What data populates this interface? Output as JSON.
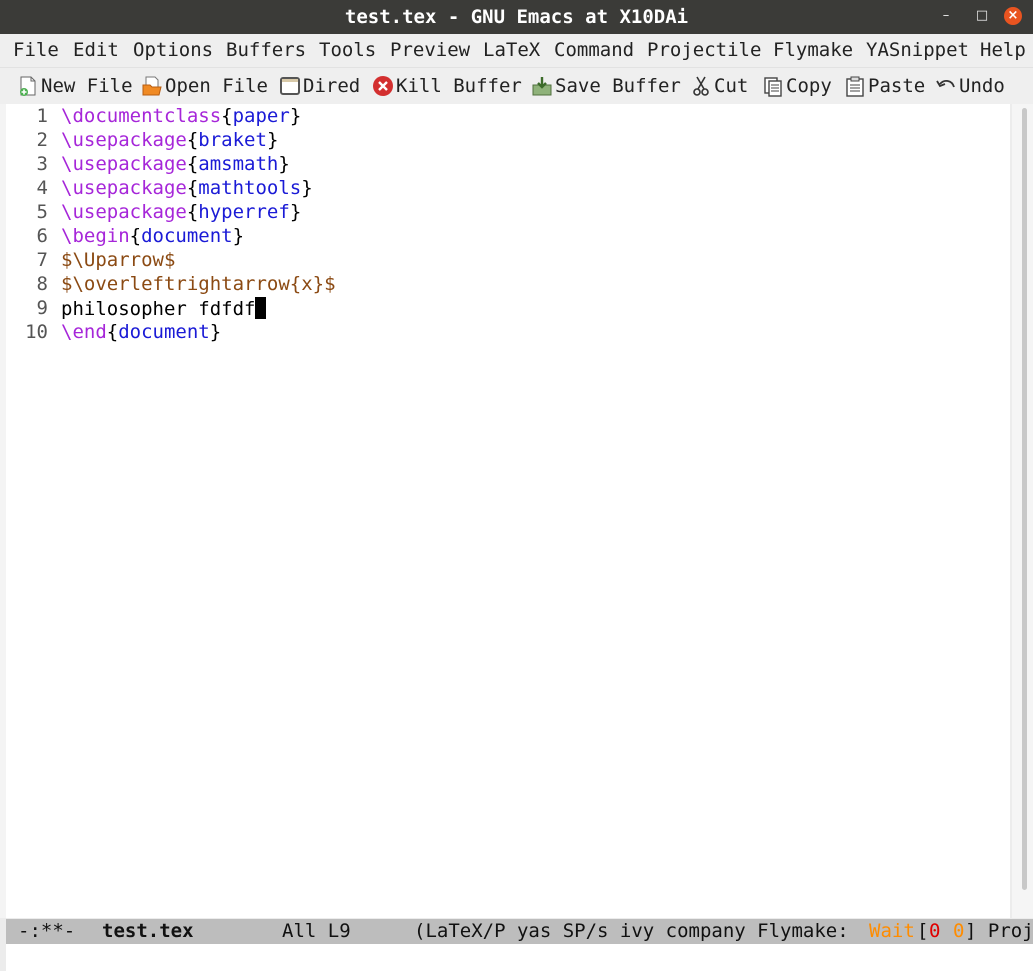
{
  "window": {
    "title": "test.tex - GNU Emacs at X10DAi",
    "minimize": "–",
    "maximize": "□",
    "close": "×"
  },
  "menubar": [
    "File",
    "Edit",
    "Options",
    "Buffers",
    "Tools",
    "Preview",
    "LaTeX",
    "Command",
    "Projectile",
    "Flymake",
    "YASnippet",
    "Help"
  ],
  "toolbar": {
    "new_file": "New File",
    "open_file": "Open File",
    "dired": "Dired",
    "kill_buffer": "Kill Buffer",
    "save_buffer": "Save Buffer",
    "cut": "Cut",
    "copy": "Copy",
    "paste": "Paste",
    "undo": "Undo"
  },
  "editor": {
    "lines": [
      {
        "num": "1",
        "segments": [
          {
            "t": "\\documentclass",
            "c": "kw"
          },
          {
            "t": "{",
            "c": ""
          },
          {
            "t": "paper",
            "c": "arg"
          },
          {
            "t": "}",
            "c": ""
          }
        ]
      },
      {
        "num": "2",
        "segments": [
          {
            "t": "\\usepackage",
            "c": "kw"
          },
          {
            "t": "{",
            "c": ""
          },
          {
            "t": "braket",
            "c": "arg"
          },
          {
            "t": "}",
            "c": ""
          }
        ]
      },
      {
        "num": "3",
        "segments": [
          {
            "t": "\\usepackage",
            "c": "kw"
          },
          {
            "t": "{",
            "c": ""
          },
          {
            "t": "amsmath",
            "c": "arg"
          },
          {
            "t": "}",
            "c": ""
          }
        ]
      },
      {
        "num": "4",
        "segments": [
          {
            "t": "\\usepackage",
            "c": "kw"
          },
          {
            "t": "{",
            "c": ""
          },
          {
            "t": "mathtools",
            "c": "arg"
          },
          {
            "t": "}",
            "c": ""
          }
        ]
      },
      {
        "num": "5",
        "segments": [
          {
            "t": "\\usepackage",
            "c": "kw"
          },
          {
            "t": "{",
            "c": ""
          },
          {
            "t": "hyperref",
            "c": "arg"
          },
          {
            "t": "}",
            "c": ""
          }
        ]
      },
      {
        "num": "6",
        "segments": [
          {
            "t": "\\begin",
            "c": "kw"
          },
          {
            "t": "{",
            "c": ""
          },
          {
            "t": "document",
            "c": "arg"
          },
          {
            "t": "}",
            "c": ""
          }
        ]
      },
      {
        "num": "7",
        "segments": [
          {
            "t": "$\\Uparrow$",
            "c": "mth"
          }
        ]
      },
      {
        "num": "8",
        "segments": [
          {
            "t": "$\\overleftrightarrow{x}$",
            "c": "mth"
          }
        ]
      },
      {
        "num": "9",
        "segments": [
          {
            "t": "philosopher fdfdf",
            "c": ""
          }
        ],
        "cursor": true
      },
      {
        "num": "10",
        "segments": [
          {
            "t": "\\end",
            "c": "kw"
          },
          {
            "t": "{",
            "c": ""
          },
          {
            "t": "document",
            "c": "arg"
          },
          {
            "t": "}",
            "c": ""
          }
        ]
      }
    ]
  },
  "modeline": {
    "status": "-:**-",
    "buffer": "test.tex",
    "position": "All L9",
    "modes": "(LaTeX/P yas SP/s ivy company Flymake:",
    "flymake_wait": "Wait",
    "bracket_open": "[",
    "err_count": "0",
    "warn_count": "0",
    "tail": "] Proj"
  },
  "colors": {
    "keyword": "#a626d9",
    "argument": "#1a1ad6",
    "math": "#8b4a13",
    "flymake_wait": "#ff8c00",
    "err": "#e00000",
    "warn": "#ff8c00"
  }
}
